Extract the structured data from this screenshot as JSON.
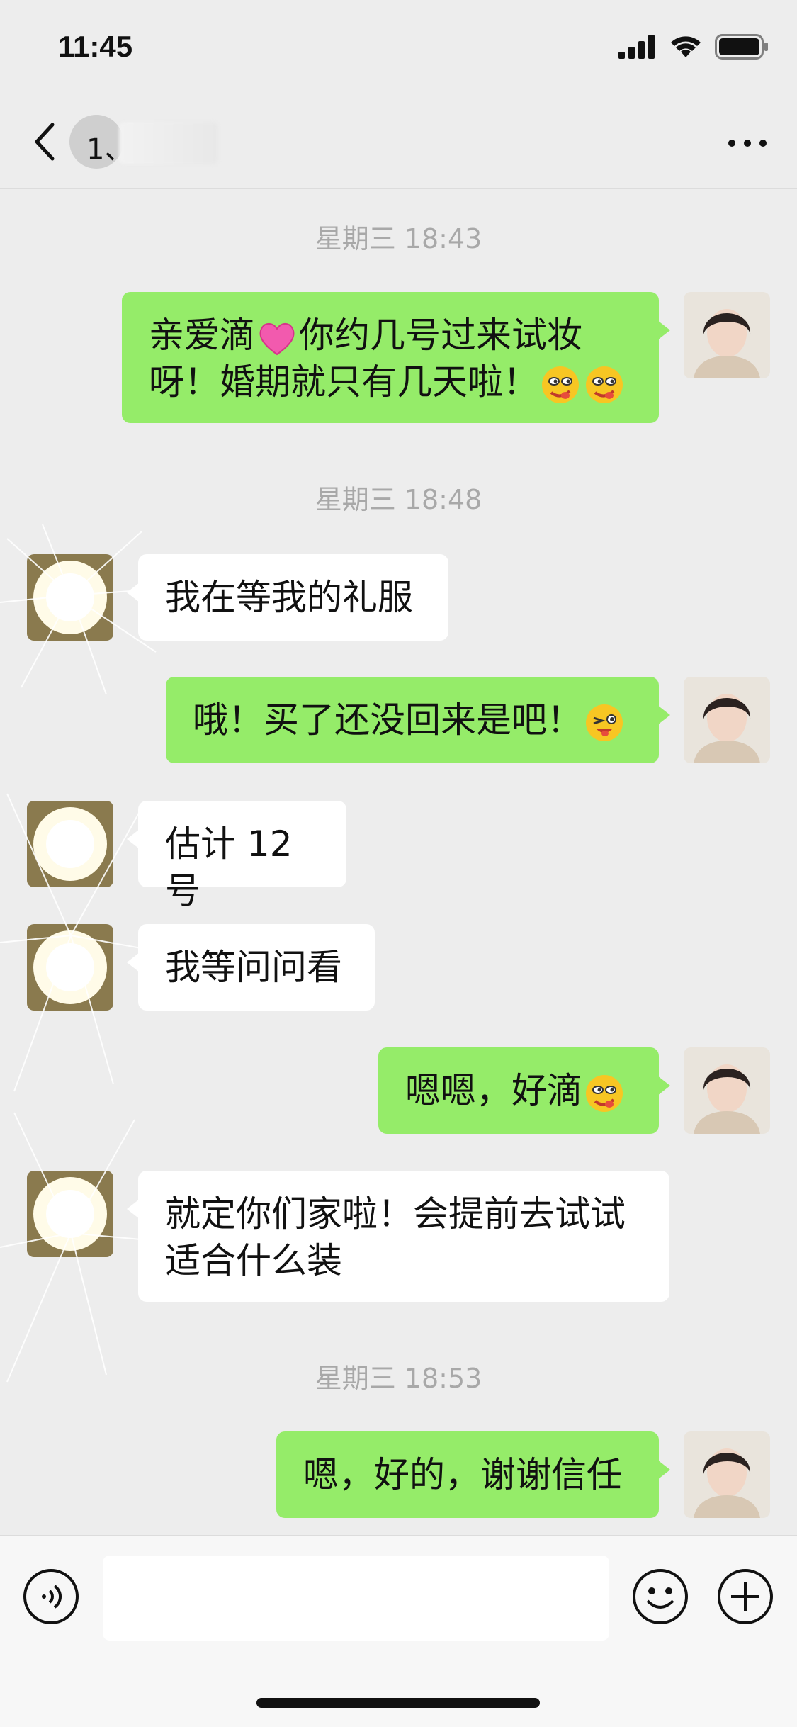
{
  "status_bar": {
    "time": "11:45"
  },
  "nav": {
    "title": "1、 • • F"
  },
  "messages": [
    {
      "type": "time",
      "text": "星期三 18:43"
    },
    {
      "type": "me",
      "line1": "亲爱滴",
      "line1b": "你约几号过来试妆",
      "line2": "呀！婚期就只有几天啦！"
    },
    {
      "type": "time",
      "text": "星期三 18:48"
    },
    {
      "type": "other",
      "text": "我在等我的礼服"
    },
    {
      "type": "me",
      "text": "哦！买了还没回来是吧！"
    },
    {
      "type": "other",
      "text": "估计 12 号"
    },
    {
      "type": "other",
      "text": "我等问问看"
    },
    {
      "type": "me",
      "text": "嗯嗯，好滴"
    },
    {
      "type": "other",
      "line1": "就定你们家啦！会提前去试试",
      "line2": "适合什么装"
    },
    {
      "type": "time",
      "text": "星期三 18:53"
    },
    {
      "type": "me",
      "text": "嗯，好的，谢谢信任"
    }
  ],
  "input": {
    "placeholder": ""
  },
  "colors": {
    "my_bubble": "#95EC69",
    "other_bubble": "#FFFFFF",
    "background": "#EDEDED"
  },
  "icons": [
    "signal-icon",
    "wifi-icon",
    "battery-icon",
    "back-chevron-icon",
    "more-icon",
    "voice-icon",
    "emoji-icon",
    "plus-icon",
    "heart-emoji",
    "smirk-emoji",
    "wink-emoji"
  ]
}
